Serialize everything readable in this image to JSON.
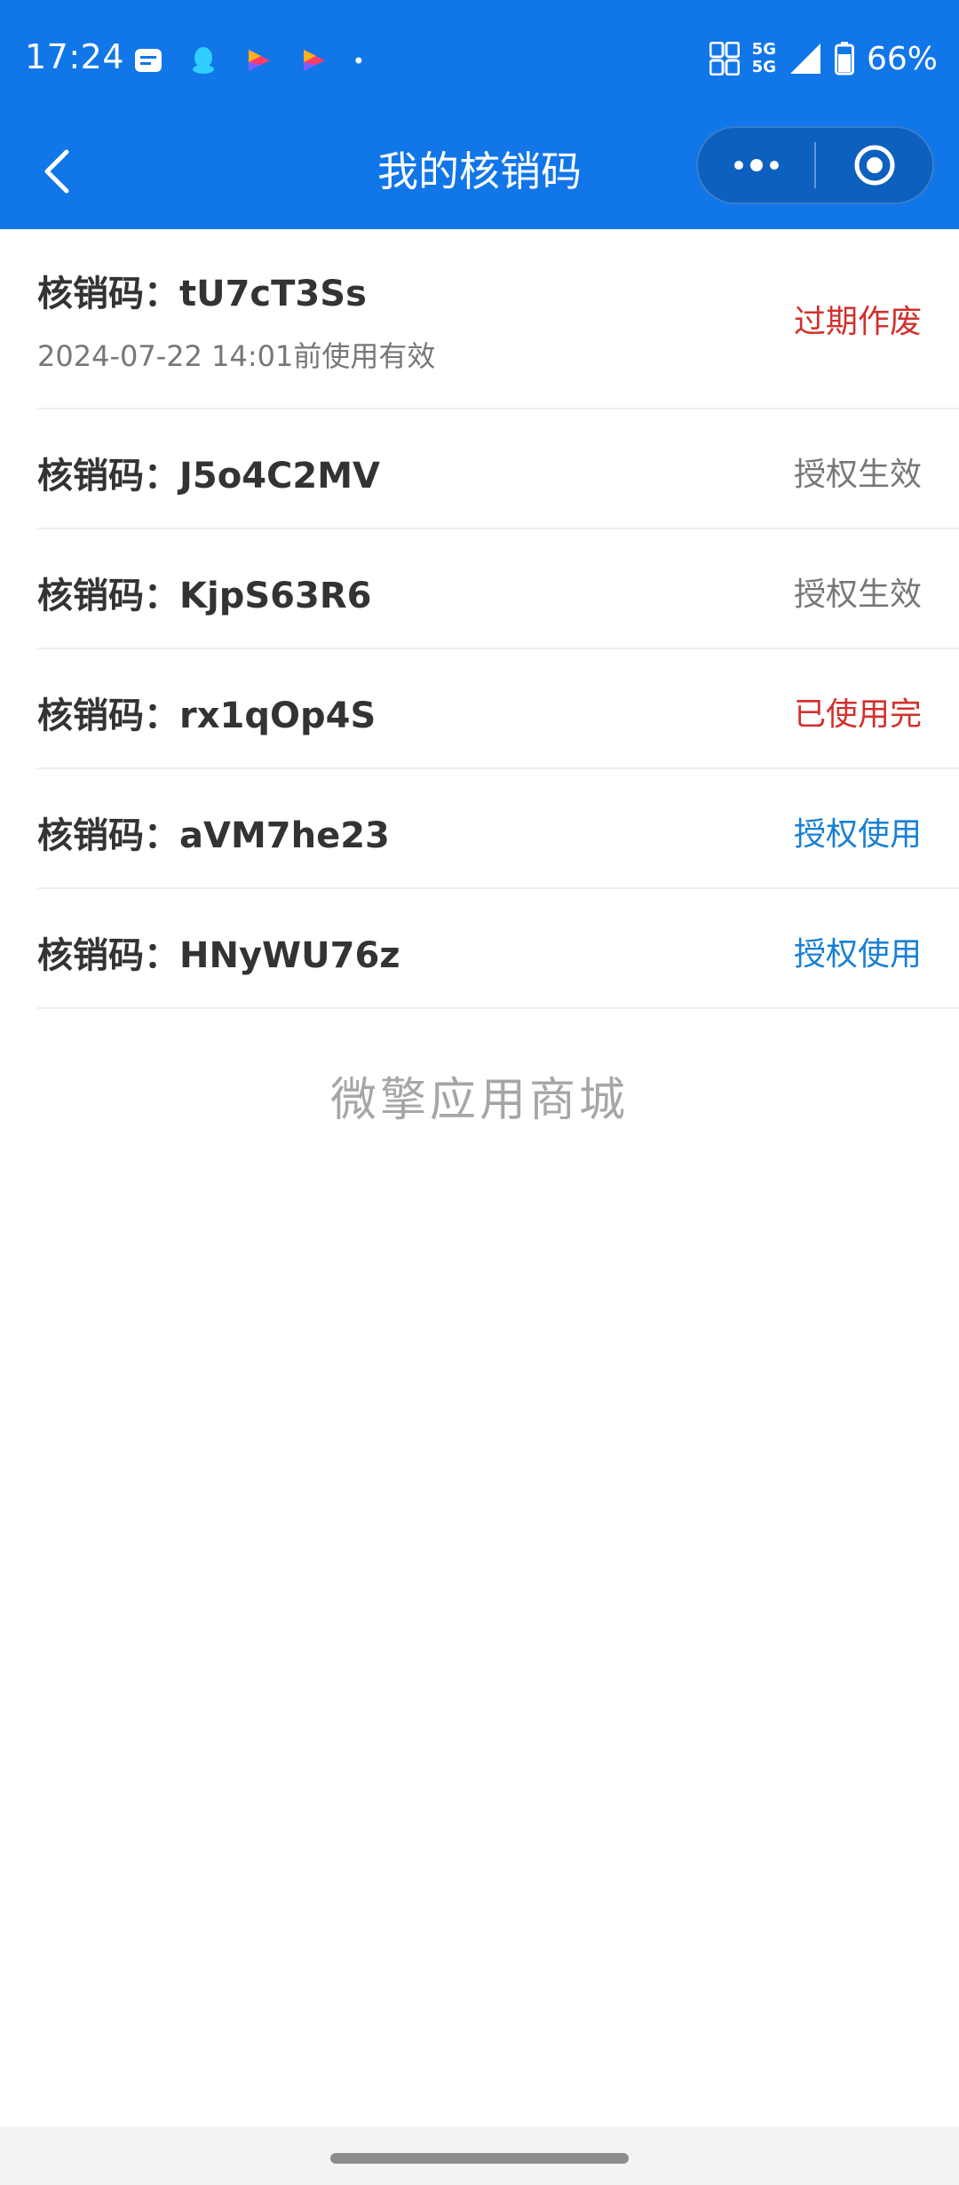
{
  "status_bar": {
    "time": "17:24",
    "network": "5G",
    "battery": "66%",
    "notification_icons": [
      "message-icon",
      "qq-penguin-icon",
      "video-play-icon",
      "video-play-icon",
      "dot-icon"
    ]
  },
  "nav": {
    "title": "我的核销码",
    "back_icon": "chevron-left-icon",
    "menu_icon": "more-dots-icon",
    "close_icon": "target-circle-icon"
  },
  "colors": {
    "primary_blue": "#1176e8",
    "red": "#d0312d",
    "gray": "#777777",
    "blue_text": "#1a7fd4"
  },
  "codes": [
    {
      "label": "核销码：",
      "code": "tU7cT3Ss",
      "validity": "2024-07-22 14:01前使用有效",
      "status": "过期作废",
      "status_color": "#d0312d"
    },
    {
      "label": "核销码：",
      "code": "J5o4C2MV",
      "status": "授权生效",
      "status_color": "#777777"
    },
    {
      "label": "核销码：",
      "code": "KjpS63R6",
      "status": "授权生效",
      "status_color": "#777777"
    },
    {
      "label": "核销码：",
      "code": "rx1qOp4S",
      "status": "已使用完",
      "status_color": "#d0312d"
    },
    {
      "label": "核销码：",
      "code": "aVM7he23",
      "status": "授权使用",
      "status_color": "#1a7fd4"
    },
    {
      "label": "核销码：",
      "code": "HNyWU76z",
      "status": "授权使用",
      "status_color": "#1a7fd4"
    }
  ],
  "footer": {
    "brand": "微擎应用商城"
  }
}
